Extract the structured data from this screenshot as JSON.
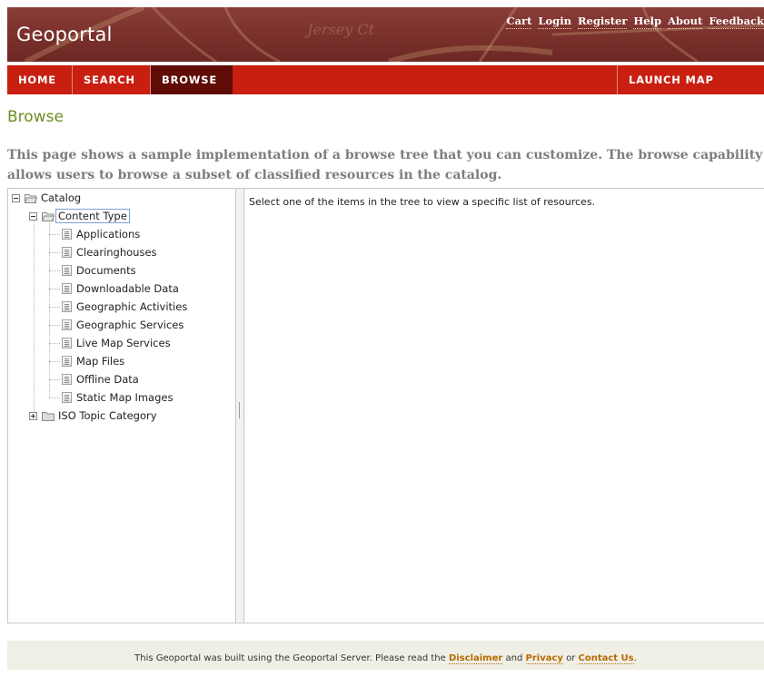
{
  "header": {
    "app_title": "Geoportal",
    "links": [
      "Cart",
      "Login",
      "Register",
      "Help",
      "About",
      "Feedback"
    ]
  },
  "nav": {
    "home": "HOME",
    "search": "SEARCH",
    "browse": "BROWSE",
    "launch": "LAUNCH MAP VIEWER"
  },
  "page": {
    "title": "Browse",
    "intro": "This page shows a sample implementation of a browse tree that you can customize. The browse capability allows users to browse a subset of classified resources in the catalog."
  },
  "tree": {
    "root": "Catalog",
    "content_type": "Content Type",
    "items": [
      "Applications",
      "Clearinghouses",
      "Documents",
      "Downloadable Data",
      "Geographic Activities",
      "Geographic Services",
      "Live Map Services",
      "Map Files",
      "Offline Data",
      "Static Map Images"
    ],
    "iso": "ISO Topic Category"
  },
  "content": {
    "message": "Select one of the items in the tree to view a specific list of resources."
  },
  "footer": {
    "text_before": "This Geoportal was built using the Geoportal Server. Please read the ",
    "disclaimer": "Disclaimer",
    "and": " and ",
    "privacy": "Privacy",
    "or": " or ",
    "contact": "Contact Us",
    "end": "."
  },
  "colors": {
    "banner": "#7a302b",
    "navbar": "#c81f10",
    "nav_active": "#5f0b06",
    "title_green": "#6b8e23",
    "footer_link": "#b86a00"
  }
}
